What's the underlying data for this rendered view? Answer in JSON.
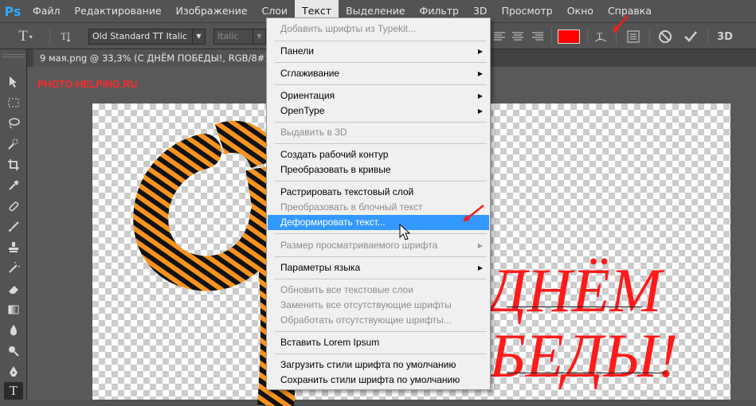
{
  "app": {
    "logo": "Ps"
  },
  "menubar": {
    "items": [
      "Файл",
      "Редактирование",
      "Изображение",
      "Слои",
      "Текст",
      "Выделение",
      "Фильтр",
      "3D",
      "Просмотр",
      "Окно",
      "Справка"
    ],
    "active_index": 4
  },
  "options": {
    "font_family": "Old Standard TT Italic",
    "font_style": "Italic",
    "text_color": "#ff0000"
  },
  "document": {
    "tab_title": "9 мая.png @ 33,3% (С ДНЁМ  ПОБЕДЫ!, RGB/8#) *"
  },
  "canvas": {
    "watermark": "PHOTO-HELPING.RU",
    "line1": "ДНЁМ",
    "line2": "БЕДЫ!"
  },
  "text_menu": {
    "items": [
      {
        "label": "Добавить шрифты из Typekit...",
        "disabled": true
      },
      {
        "label": "Панели",
        "submenu": true
      },
      {
        "label": "Сглаживание",
        "submenu": true
      },
      {
        "label": "Ориентация",
        "submenu": true
      },
      {
        "label": "OpenType",
        "submenu": true
      },
      {
        "label": "Выдавить в 3D",
        "disabled": true
      },
      {
        "label": "Создать рабочий контур"
      },
      {
        "label": "Преобразовать в кривые"
      },
      {
        "label": "Растрировать текстовый слой"
      },
      {
        "label": "Преобразовать в блочный текст",
        "disabled": true
      },
      {
        "label": "Деформировать текст...",
        "highlighted": true
      },
      {
        "label": "Размер просматриваемого шрифта",
        "disabled": true,
        "submenu": true
      },
      {
        "label": "Параметры языка",
        "submenu": true
      },
      {
        "label": "Обновить все текстовые слои",
        "disabled": true
      },
      {
        "label": "Заменить все отсутствующие шрифты",
        "disabled": true
      },
      {
        "label": "Обработать отсутствующие шрифты...",
        "disabled": true
      },
      {
        "label": "Вставить Lorem Ipsum"
      },
      {
        "label": "Загрузить стили шрифта по умолчанию"
      },
      {
        "label": "Сохранить стили шрифта по умолчанию"
      }
    ]
  },
  "colors": {
    "accent": "#3399ff",
    "annotation": "#ff0000"
  }
}
